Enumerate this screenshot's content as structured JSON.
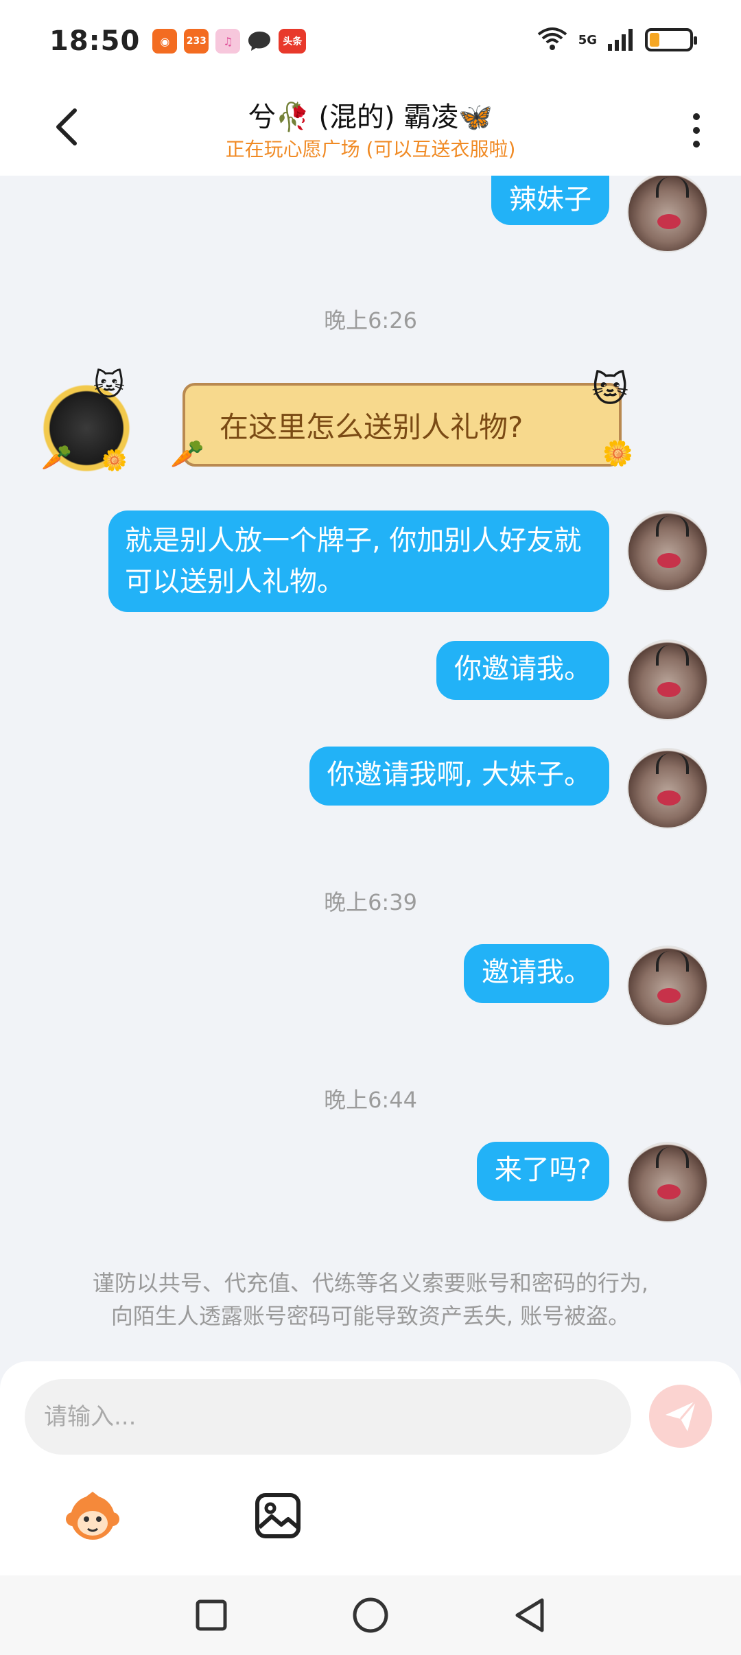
{
  "status_bar": {
    "time": "18:50",
    "notif_badge": "233",
    "news_badge": "头条",
    "network": "5G",
    "battery_level": 0.25,
    "icons": [
      "app-icon",
      "app-233-icon",
      "music-icon",
      "message-icon",
      "toutiao-icon",
      "wifi-icon",
      "signal-icon",
      "battery-icon"
    ]
  },
  "header": {
    "title": "兮🥀 (混的) 霸凌🦋",
    "subtitle": "正在玩心愿广场 (可以互送衣服啦)"
  },
  "messages": [
    {
      "side": "right",
      "text": "辣妹子"
    },
    {
      "type": "time",
      "text": "晚上6:26"
    },
    {
      "side": "left",
      "text": "在这里怎么送别人礼物?"
    },
    {
      "side": "right",
      "text": "就是别人放一个牌子, 你加别人好友就可以送别人礼物。"
    },
    {
      "side": "right",
      "text": "你邀请我。"
    },
    {
      "side": "right",
      "text": "你邀请我啊, 大妹子。"
    },
    {
      "type": "time",
      "text": "晚上6:39"
    },
    {
      "side": "right",
      "text": "邀请我。"
    },
    {
      "type": "time",
      "text": "晚上6:44"
    },
    {
      "side": "right",
      "text": "来了吗?"
    }
  ],
  "warning": {
    "line1": "谨防以共号、代充值、代练等名义索要账号和密码的行为,",
    "line2": "向陌生人透露账号密码可能导致资产丢失, 账号被盗。"
  },
  "input": {
    "placeholder": "请输入..."
  },
  "colors": {
    "bubble_right": "#22b2f7",
    "bubble_left": "#f7d98d",
    "subtitle": "#f08a24",
    "send_button": "#fbd3d0"
  }
}
